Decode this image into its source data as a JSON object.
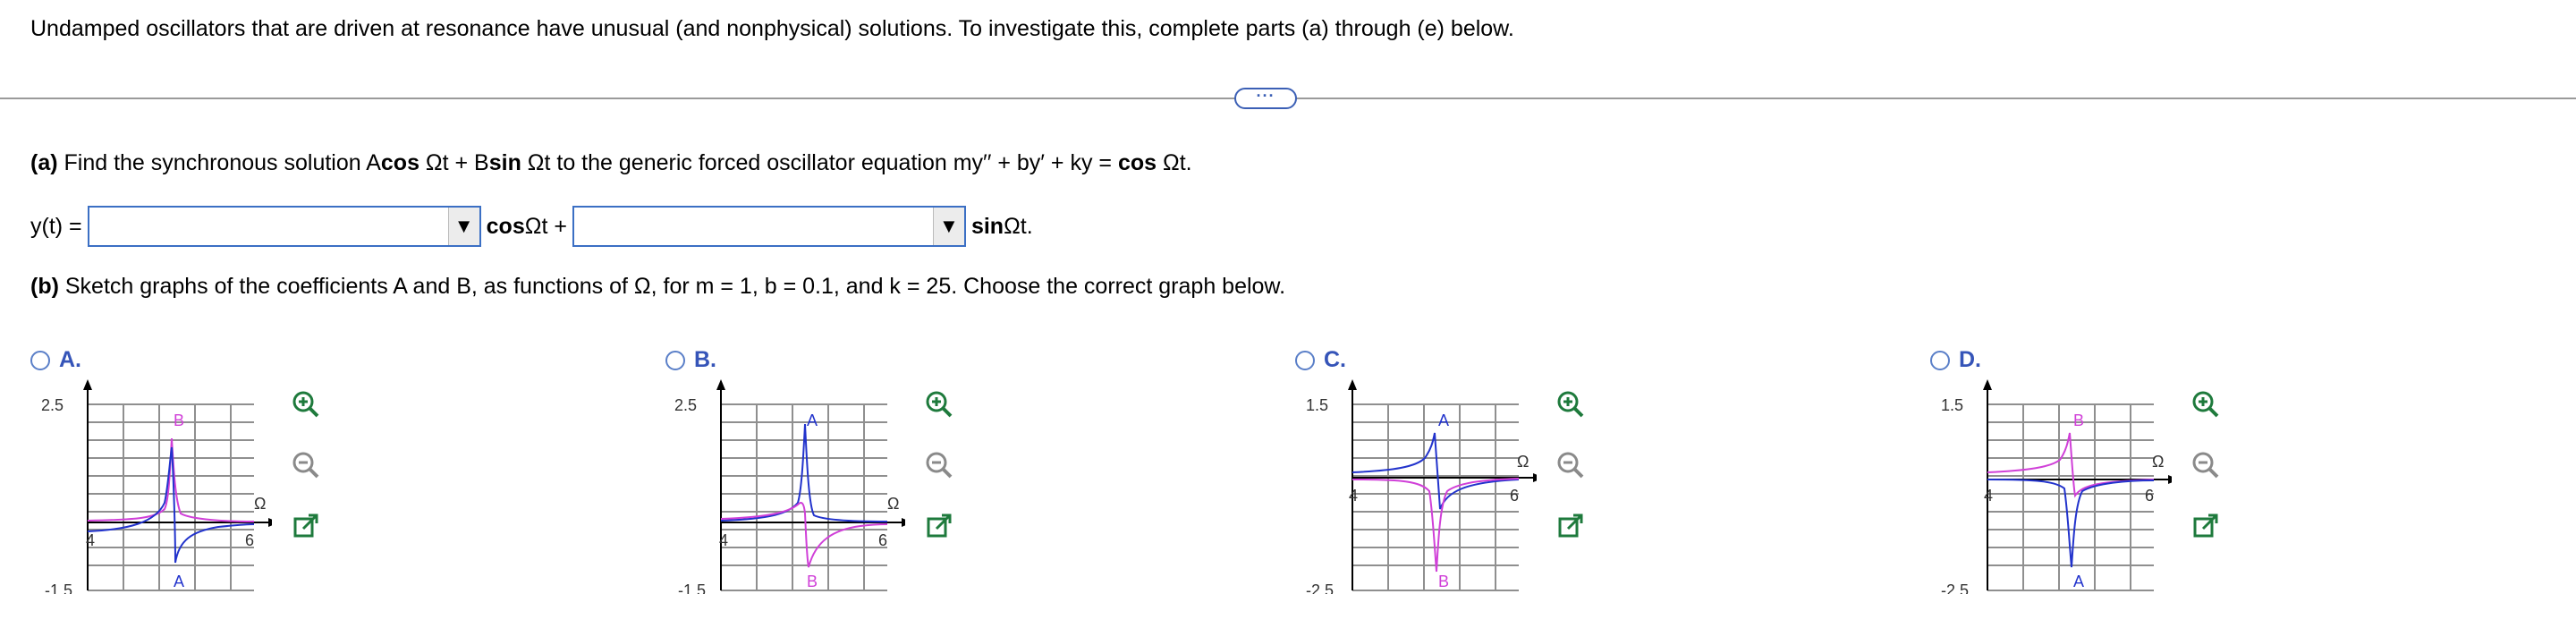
{
  "intro": "Undamped oscillators that are driven at resonance have unusual (and nonphysical) solutions. To investigate this, complete parts (a) through (e) below.",
  "more_label": "···",
  "part_a": {
    "label": "(a)",
    "text_prefix": " Find the synchronous solution A",
    "text_mid1": "cos",
    "text_mid2": " Ωt + B",
    "text_mid3": "sin",
    "text_mid4": " Ωt to the generic forced oscillator equation my′′ + by′ + ky = ",
    "text_cos": "cos",
    "text_end": " Ωt.",
    "y_label": "y(t) =",
    "cos_term": "cos",
    "cos_rest": " Ωt +",
    "sin_term": "sin",
    "sin_rest": " Ωt."
  },
  "part_b": {
    "label": "(b)",
    "text": " Sketch graphs of the coefficients A and B, as functions of Ω, for m = 1, b = 0.1, and k = 25. Choose the correct graph below."
  },
  "options": [
    {
      "letter": "A.",
      "ytop": "2.5",
      "ybot": "-1.5",
      "xtick_left": "4",
      "xtick_right": "6",
      "axis_label": "Ω",
      "peak_label": "B",
      "dip_label": "A"
    },
    {
      "letter": "B.",
      "ytop": "2.5",
      "ybot": "-1.5",
      "xtick_left": "4",
      "xtick_right": "6",
      "axis_label": "Ω",
      "peak_label": "A",
      "dip_label": "B"
    },
    {
      "letter": "C.",
      "ytop": "1.5",
      "ybot": "-2.5",
      "xtick_left": "4",
      "xtick_right": "6",
      "axis_label": "Ω",
      "peak_label": "A",
      "dip_label": "B"
    },
    {
      "letter": "D.",
      "ytop": "1.5",
      "ybot": "-2.5",
      "xtick_left": "4",
      "xtick_right": "6",
      "axis_label": "Ω",
      "peak_label": "B",
      "dip_label": "A"
    }
  ],
  "colors": {
    "blue_curve": "#2233cc",
    "magenta_curve": "#d040d8",
    "option_text": "#3554b8",
    "tool_green": "#1e7a3c",
    "tool_gray": "#8a8a8a"
  },
  "icons": {
    "zoom_in": "zoom-in-icon",
    "zoom_out": "zoom-out-icon",
    "popout": "popout-icon"
  }
}
